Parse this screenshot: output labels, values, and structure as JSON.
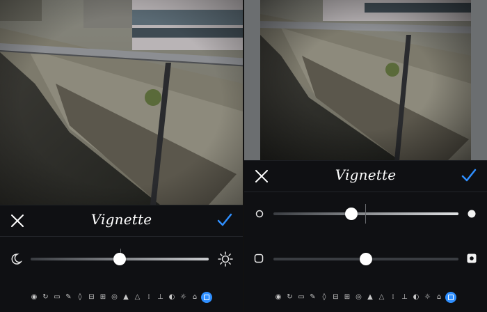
{
  "left_screen": {
    "title": "Vignette",
    "slider_value": 0.5
  },
  "right_screen": {
    "title": "Vignette",
    "radius_slider_value": 0.42,
    "strength_slider_value": 0.5
  },
  "toolbar": {
    "active_tool": "vignette",
    "tools": [
      "eye-icon",
      "rotate-icon",
      "crop-icon",
      "brush-icon",
      "drop-icon",
      "straighten-icon",
      "print-icon",
      "spiral-icon",
      "triangle-icon",
      "triangle-outline-icon",
      "grain-icon",
      "thermometer-icon",
      "contrast-icon",
      "sun-icon",
      "ui-icon",
      "vignette-icon"
    ]
  },
  "colors": {
    "accent": "#2f8fff",
    "panel": "#0f1013",
    "text": "#ffffff"
  },
  "icons": {
    "close": "close-icon",
    "confirm": "checkmark-icon",
    "left_min": "moon-icon",
    "left_max": "sun-icon",
    "right_row1_min": "circle-outline-icon",
    "right_row1_max": "circle-filled-icon",
    "right_row2_min": "rounded-square-outline-icon",
    "right_row2_max": "square-dot-icon"
  }
}
